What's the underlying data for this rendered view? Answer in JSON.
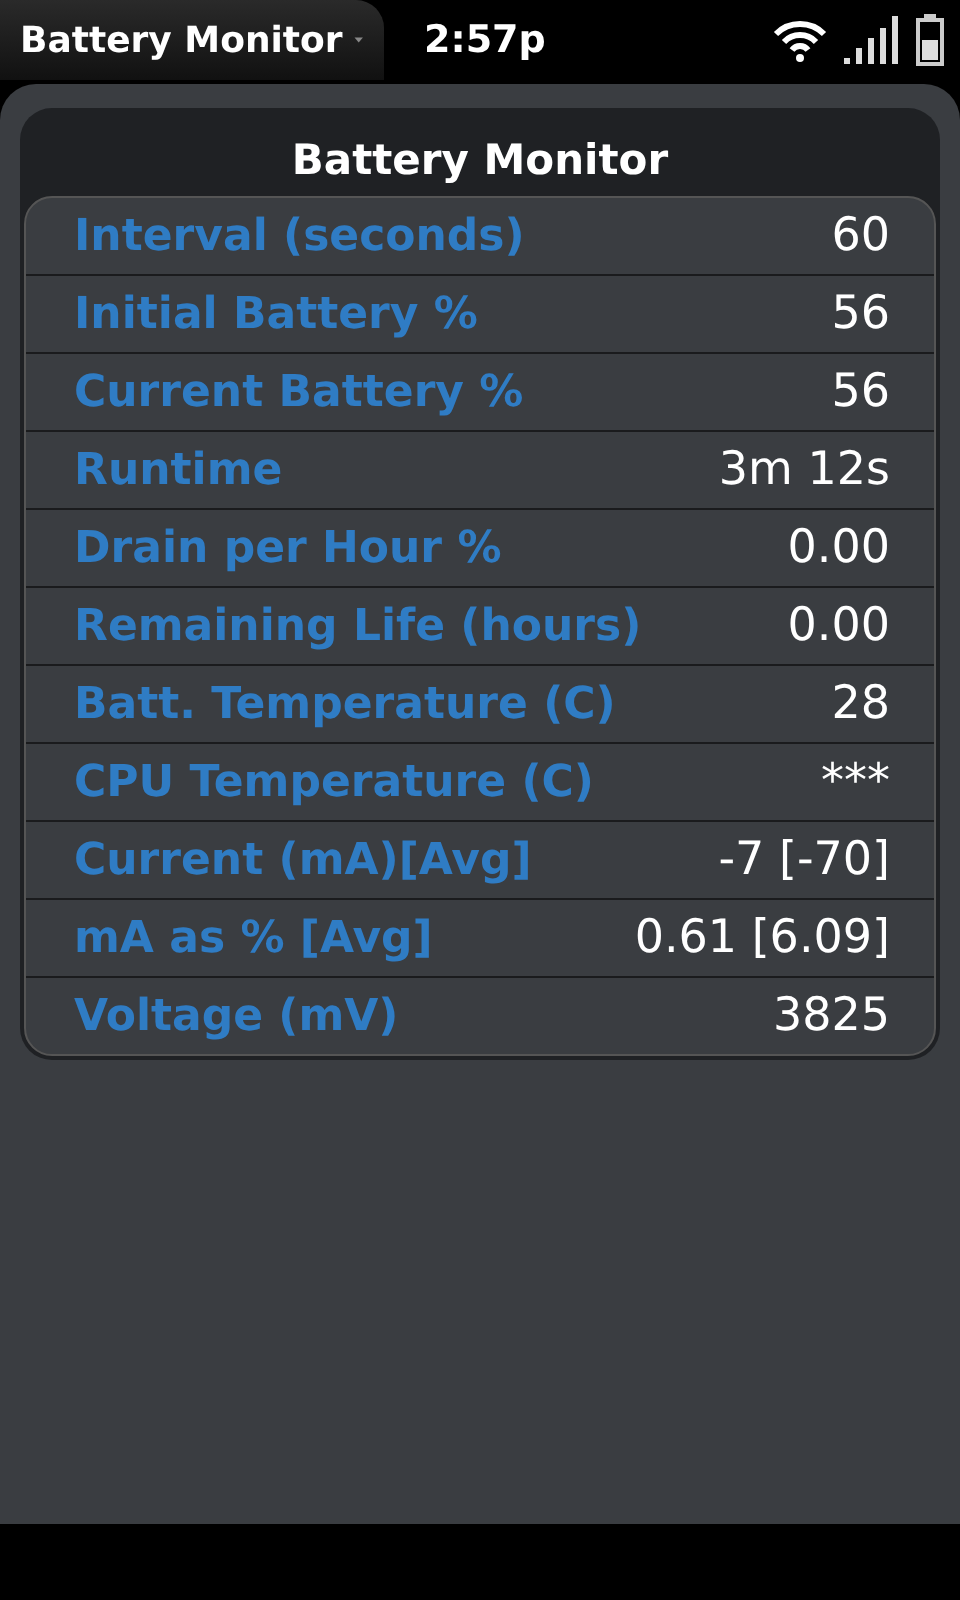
{
  "status_bar": {
    "app_menu": "Battery Monitor",
    "time": "2:57p"
  },
  "panel": {
    "title": "Battery Monitor",
    "rows": [
      {
        "label": "Interval (seconds)",
        "value": "60"
      },
      {
        "label": "Initial Battery %",
        "value": "56"
      },
      {
        "label": "Current Battery %",
        "value": "56"
      },
      {
        "label": "Runtime",
        "value": "3m 12s"
      },
      {
        "label": "Drain per Hour %",
        "value": "0.00"
      },
      {
        "label": "Remaining Life (hours)",
        "value": "0.00"
      },
      {
        "label": "Batt. Temperature (C)",
        "value": "28"
      },
      {
        "label": "CPU Temperature (C)",
        "value": "***"
      },
      {
        "label": "Current (mA)[Avg]",
        "value": "-7 [-70]"
      },
      {
        "label": "mA as % [Avg]",
        "value": "0.61 [6.09]"
      },
      {
        "label": "Voltage (mV)",
        "value": "3825"
      }
    ]
  }
}
